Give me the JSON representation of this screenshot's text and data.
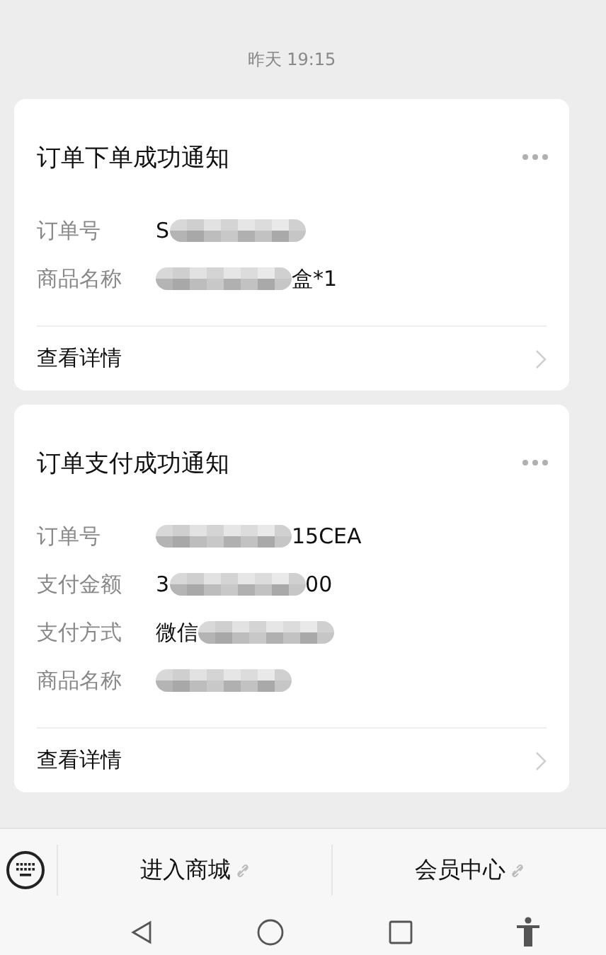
{
  "timestamp": "昨天 19:15",
  "cards": [
    {
      "title": "订单下单成功通知",
      "fields": [
        {
          "label": "订单号",
          "value_before": "S",
          "redacted": true
        },
        {
          "label": "商品名称",
          "redacted": true,
          "value_after": "盒*1"
        }
      ],
      "link": "查看详情"
    },
    {
      "title": "订单支付成功通知",
      "fields": [
        {
          "label": "订单号",
          "redacted": true,
          "value_after": "15CEA"
        },
        {
          "label": "支付金额",
          "value_before": "3",
          "redacted": true,
          "value_after": "00"
        },
        {
          "label": "支付方式",
          "value_before": "微信",
          "redacted": true
        },
        {
          "label": "商品名称",
          "redacted": true
        }
      ],
      "link": "查看详情"
    }
  ],
  "menu": [
    {
      "label": "进入商城"
    },
    {
      "label": "会员中心"
    }
  ]
}
